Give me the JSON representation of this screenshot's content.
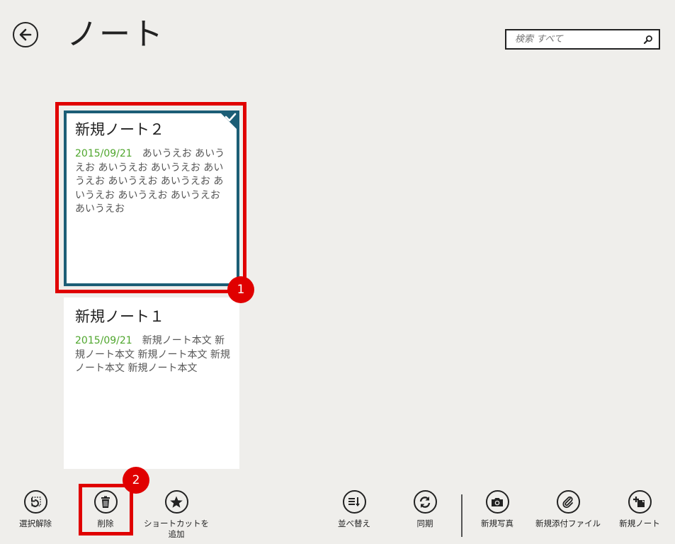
{
  "header": {
    "title": "ノート",
    "search_placeholder": "検索 すべて"
  },
  "notes": [
    {
      "title": "新規ノート２",
      "date": "2015/09/21",
      "body": "あいうえお あいうえお あいうえお あいうえお あいうえお あいうえお あいうえお あいうえお あいうえお あいうえお あいうえお",
      "selected": true
    },
    {
      "title": "新規ノート１",
      "date": "2015/09/21",
      "body": "新規ノート本文 新規ノート本文 新規ノート本文 新規ノート本文 新規ノート本文",
      "selected": false
    }
  ],
  "annotations": {
    "step1": "1",
    "step2": "2"
  },
  "appbar": {
    "left": [
      {
        "label": "選択解除",
        "icon": "clear-selection-icon"
      },
      {
        "label": "削除",
        "icon": "trash-icon"
      },
      {
        "label": "ショートカットを追加",
        "icon": "star-icon"
      }
    ],
    "right": [
      {
        "label": "並べ替え",
        "icon": "sort-icon"
      },
      {
        "label": "同期",
        "icon": "sync-icon"
      },
      {
        "label": "新規写真",
        "icon": "camera-icon"
      },
      {
        "label": "新規添付ファイル",
        "icon": "paperclip-icon"
      },
      {
        "label": "新規ノート",
        "icon": "new-note-icon"
      }
    ]
  },
  "colors": {
    "background": "#efeeeb",
    "selection_border": "#1c5e76",
    "date_green": "#4fa62d",
    "annotation_red": "#e00000"
  }
}
